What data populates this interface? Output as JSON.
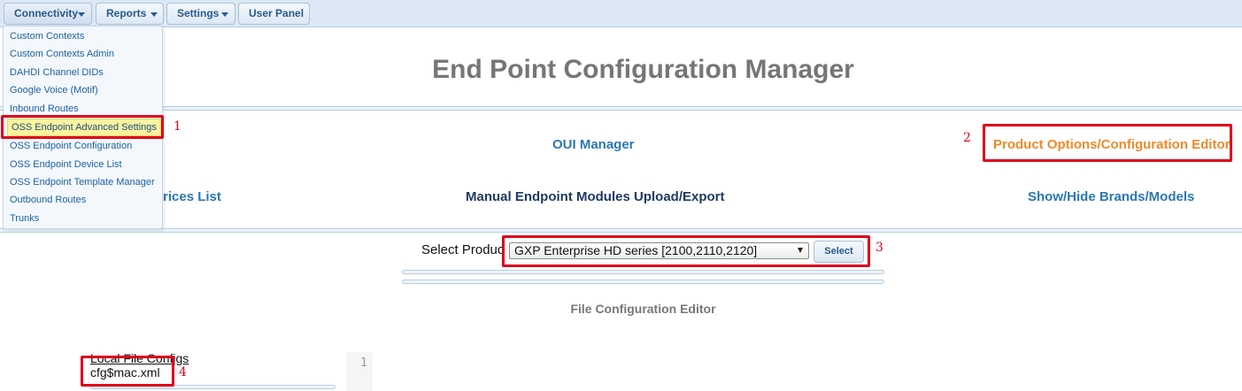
{
  "menu": {
    "connectivity": "Connectivity",
    "reports": "Reports",
    "settings": "Settings",
    "user_panel": "User Panel"
  },
  "dropdown": {
    "items": [
      "Custom Contexts",
      "Custom Contexts Admin",
      "DAHDI Channel DIDs",
      "Google Voice (Motif)",
      "Inbound Routes",
      "OSS Endpoint Advanced Settings",
      "OSS Endpoint Configuration",
      "OSS Endpoint Device List",
      "OSS Endpoint Template Manager",
      "Outbound Routes",
      "Trunks"
    ],
    "highlighted": "OSS Endpoint Advanced Settings"
  },
  "page": {
    "title": "End Point Configuration Manager"
  },
  "links": {
    "oui_manager": "OUI Manager",
    "product_options": "Product Options/Configuration Editor",
    "devices_list_partial": "rices List",
    "manual_upload": "Manual Endpoint Modules Upload/Export",
    "show_hide": "Show/Hide Brands/Models"
  },
  "product": {
    "label": "Select Produc",
    "selected": "GXP Enterprise HD series [2100,2110,2120]",
    "button": "Select"
  },
  "editor": {
    "title": "File Configuration Editor",
    "local_configs": "Local File Configs",
    "file": "cfg$mac.xml",
    "line_number": "1"
  },
  "annotations": [
    "1",
    "2",
    "3",
    "4"
  ],
  "colors": {
    "link": "#2b78b4",
    "link_active": "#ee8a2a",
    "annotation": "#e0001b",
    "highlight": "#fbf39e"
  }
}
